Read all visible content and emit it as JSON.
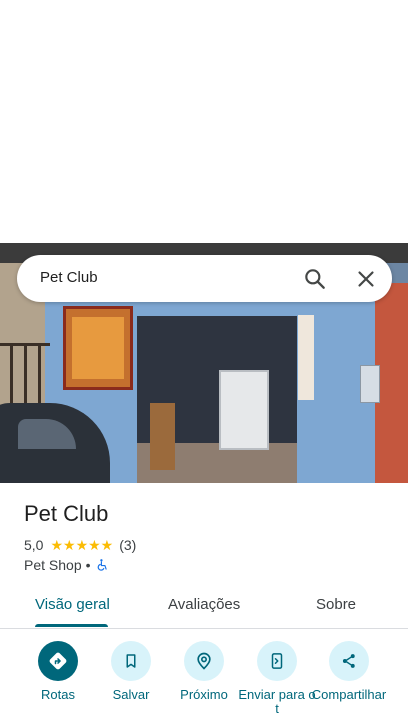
{
  "search": {
    "query": "Pet Club"
  },
  "place": {
    "name": "Pet Club",
    "rating": "5,0",
    "stars": "★★★★★",
    "reviews_count": "(3)",
    "category": "Pet Shop",
    "separator": "•"
  },
  "tabs": [
    {
      "label": "Visão geral",
      "active": true
    },
    {
      "label": "Avaliações",
      "active": false
    },
    {
      "label": "Sobre",
      "active": false
    }
  ],
  "actions": [
    {
      "label": "Rotas",
      "icon": "directions-icon"
    },
    {
      "label": "Salvar",
      "icon": "bookmark-icon"
    },
    {
      "label": "Próximo",
      "icon": "nearby-icon"
    },
    {
      "label": "Enviar para o t",
      "icon": "send-to-phone-icon"
    },
    {
      "label": "Compartilhar",
      "icon": "share-icon"
    }
  ],
  "colors": {
    "accent": "#00677b",
    "accent_light": "#d8f3fa",
    "star": "#fbbc04"
  }
}
